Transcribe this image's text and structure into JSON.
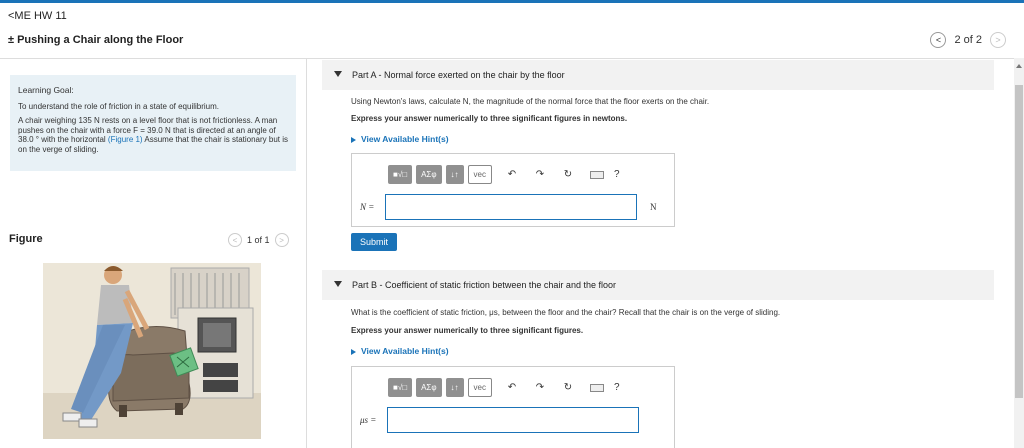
{
  "header": {
    "back_label": "<ME HW 11",
    "title": "± Pushing a Chair along the Floor",
    "pager": {
      "prev": "<",
      "text": "2 of 2",
      "next": ">"
    }
  },
  "goal": {
    "heading": "Learning Goal:",
    "text1": "To understand the role of friction in a state of equilibrium.",
    "text2_a": "A chair weighing 135 N rests on a level floor that is not frictionless. A man pushes on the chair with a force F = 39.0 N that is directed at an angle of 38.0 ° with the horizontal ",
    "text2_link": "(Figure 1)",
    "text2_b": " Assume that the chair is stationary but is on the verge of sliding."
  },
  "figure": {
    "label": "Figure",
    "pager": "1 of 1",
    "prev": "<",
    "next": ">"
  },
  "partA": {
    "heading": "Part A - Normal force exerted on the chair by the floor",
    "question": "Using Newton's laws, calculate N, the magnitude of the normal force that the floor exerts on the chair.",
    "instruction": "Express your answer numerically to three significant figures in newtons.",
    "hint": "View Available Hint(s)",
    "var": "N =",
    "unit": "N",
    "submit": "Submit"
  },
  "partB": {
    "heading": "Part B - Coefficient of static friction between the chair and the floor",
    "question": "What is the coefficient of static friction, μs, between the floor and the chair? Recall that the chair is on the verge of sliding.",
    "instruction": "Express your answer numerically to three significant figures.",
    "hint": "View Available Hint(s)",
    "var": "μs ="
  },
  "toolbar": {
    "templates": "■√□",
    "greek": "ΑΣφ",
    "arrows": "↓↑",
    "vec": "vec",
    "undo": "↶",
    "redo": "↷",
    "reset": "↻",
    "help": "?"
  },
  "colors": {
    "accent": "#1a73b8",
    "goal_bg": "#e8f1f6",
    "section_bg": "#f2f2f2"
  }
}
